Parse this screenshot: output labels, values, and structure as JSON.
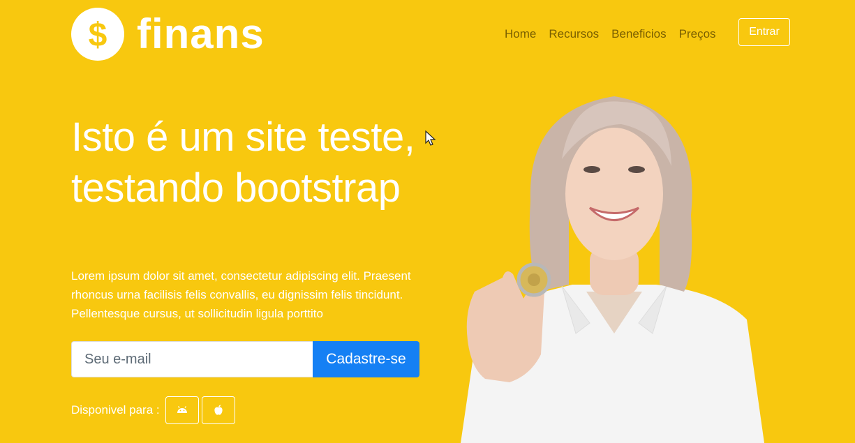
{
  "brand": {
    "name": "finans",
    "logo_icon": "dollar-coin-icon"
  },
  "nav": {
    "items": [
      {
        "label": "Home"
      },
      {
        "label": "Recursos"
      },
      {
        "label": "Beneficios"
      },
      {
        "label": "Preços"
      }
    ]
  },
  "header": {
    "login_label": "Entrar"
  },
  "hero": {
    "title": "Isto é um site teste, testando bootstrap",
    "text": "Lorem ipsum dolor sit amet, consectetur adipiscing elit. Praesent rhoncus urna facilisis felis convallis, eu dignissim felis tincidunt. Pellentesque cursus, ut sollicitudin ligula porttito"
  },
  "signup": {
    "email_placeholder": "Seu e-mail",
    "email_value": "",
    "button_label": "Cadastre-se"
  },
  "availability": {
    "label": "Disponivel para :",
    "platforms": [
      {
        "icon": "android-icon"
      },
      {
        "icon": "apple-icon"
      }
    ]
  },
  "colors": {
    "background": "#f8c80f",
    "primary_button": "#1580f4",
    "text_light": "#ffffff",
    "nav_text": "#7a5f00"
  }
}
